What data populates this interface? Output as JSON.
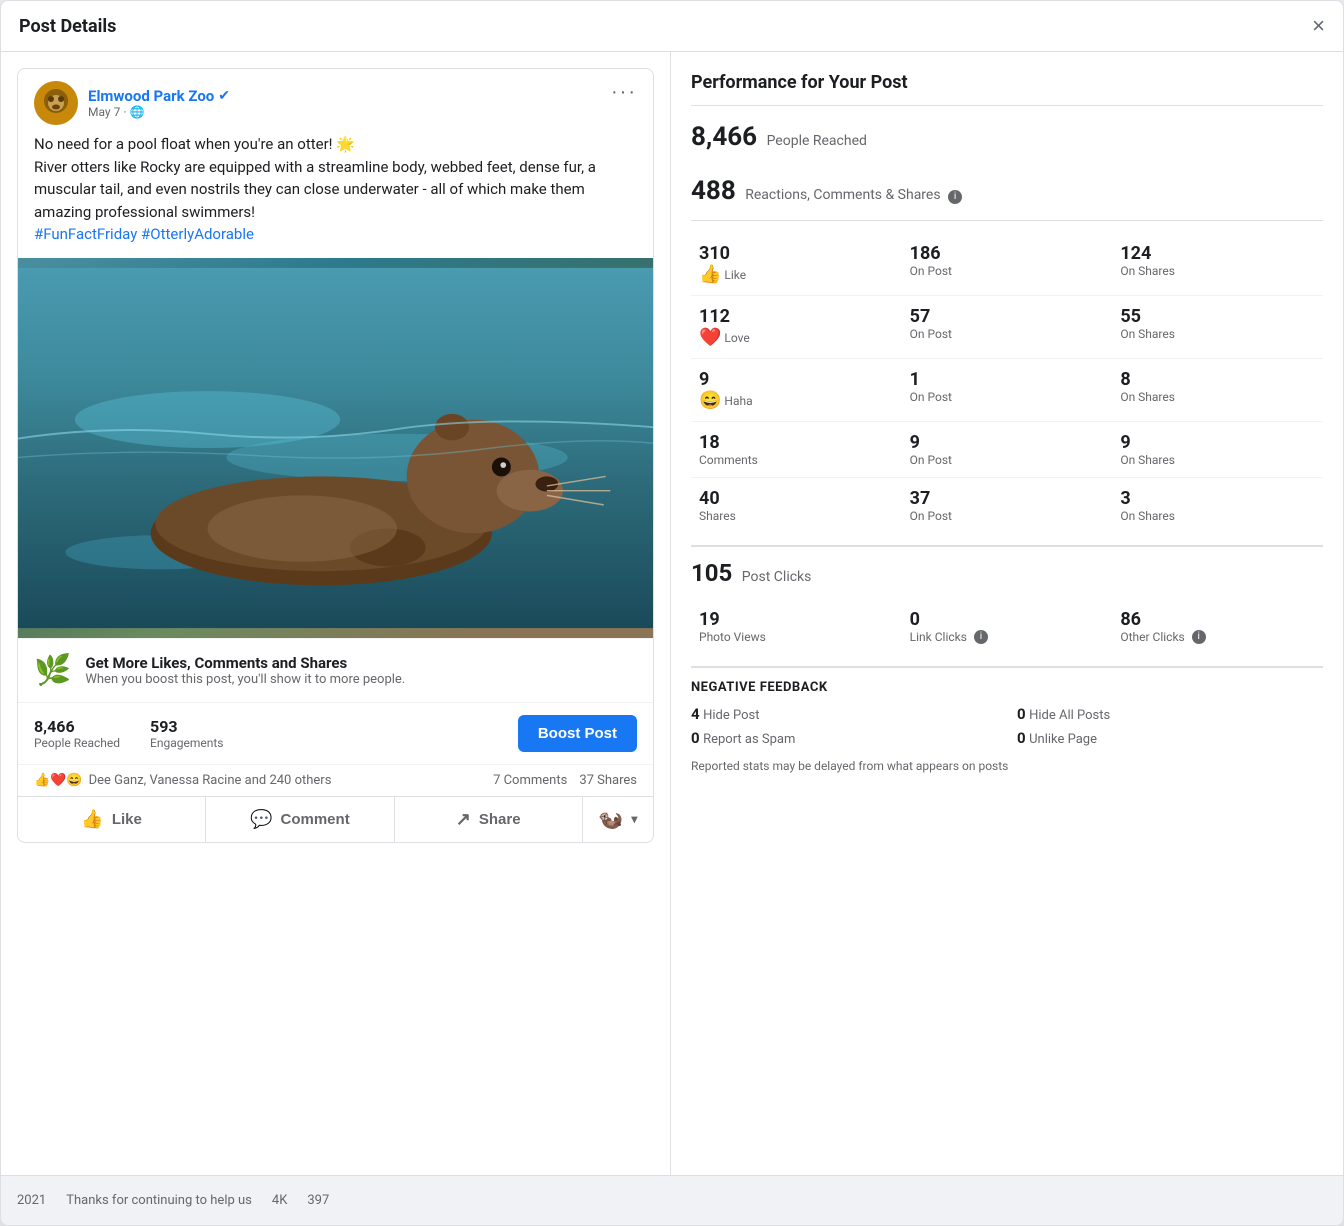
{
  "modal": {
    "title": "Post Details",
    "close_label": "×"
  },
  "post": {
    "page_name": "Elmwood Park Zoo",
    "verified": true,
    "date": "May 7",
    "privacy": "🌐",
    "text_line1": "No need for a pool float when you're an otter! 🌟",
    "text_line2": "River otters like Rocky are equipped with a streamline body, webbed feet, dense fur, a muscular tail, and even nostrils they can close underwater - all of which make them amazing professional swimmers!",
    "hashtags": "#FunFactFriday #OtterlyAdorable",
    "more_btn_label": "···"
  },
  "boost": {
    "title": "Get More Likes, Comments and Shares",
    "subtitle": "When you boost this post, you'll show it to more people.",
    "btn_label": "Boost Post"
  },
  "post_stats": {
    "people_reached_num": "8,466",
    "people_reached_label": "People Reached",
    "engagements_num": "593",
    "engagements_label": "Engagements"
  },
  "reactions_row": {
    "names": "Dee Ganz, Vanessa Racine and 240 others",
    "comments_label": "7 Comments",
    "shares_label": "37 Shares"
  },
  "action_bar": {
    "like_label": "Like",
    "comment_label": "Comment",
    "share_label": "Share"
  },
  "performance": {
    "title": "Performance for Your Post",
    "people_reached_num": "8,466",
    "people_reached_label": "People Reached",
    "rcs_num": "488",
    "rcs_label": "Reactions, Comments & Shares",
    "metrics": [
      {
        "col1_num": "310",
        "col1_label": "Like",
        "col1_emoji": "👍",
        "col1_color": "#1877f2",
        "col2_num": "186",
        "col2_label": "On Post",
        "col3_num": "124",
        "col3_label": "On Shares"
      },
      {
        "col1_num": "112",
        "col1_label": "Love",
        "col1_emoji": "❤️",
        "col1_color": "#e0245e",
        "col2_num": "57",
        "col2_label": "On Post",
        "col3_num": "55",
        "col3_label": "On Shares"
      },
      {
        "col1_num": "9",
        "col1_label": "Haha",
        "col1_emoji": "😄",
        "col1_color": "#f7b928",
        "col2_num": "1",
        "col2_label": "On Post",
        "col3_num": "8",
        "col3_label": "On Shares"
      },
      {
        "col1_num": "18",
        "col1_label": "Comments",
        "col1_emoji": null,
        "col2_num": "9",
        "col2_label": "On Post",
        "col3_num": "9",
        "col3_label": "On Shares"
      },
      {
        "col1_num": "40",
        "col1_label": "Shares",
        "col1_emoji": null,
        "col2_num": "37",
        "col2_label": "On Post",
        "col3_num": "3",
        "col3_label": "On Shares"
      }
    ],
    "post_clicks_num": "105",
    "post_clicks_label": "Post Clicks",
    "click_details": [
      {
        "num": "19",
        "label": "Photo Views",
        "has_info": false
      },
      {
        "num": "0",
        "label": "Link Clicks",
        "has_info": true
      },
      {
        "num": "86",
        "label": "Other Clicks",
        "has_info": true
      }
    ],
    "neg_feedback_title": "NEGATIVE FEEDBACK",
    "neg_feedback": [
      {
        "num": "4",
        "label": "Hide Post"
      },
      {
        "num": "0",
        "label": "Hide All Posts"
      },
      {
        "num": "0",
        "label": "Report as Spam"
      },
      {
        "num": "0",
        "label": "Unlike Page"
      }
    ],
    "disclaimer": "Reported stats may be delayed from what appears on posts"
  },
  "bottom_bar": {
    "year": "2021",
    "text": "Thanks for continuing to help us",
    "num": "4K",
    "extra": "397"
  }
}
